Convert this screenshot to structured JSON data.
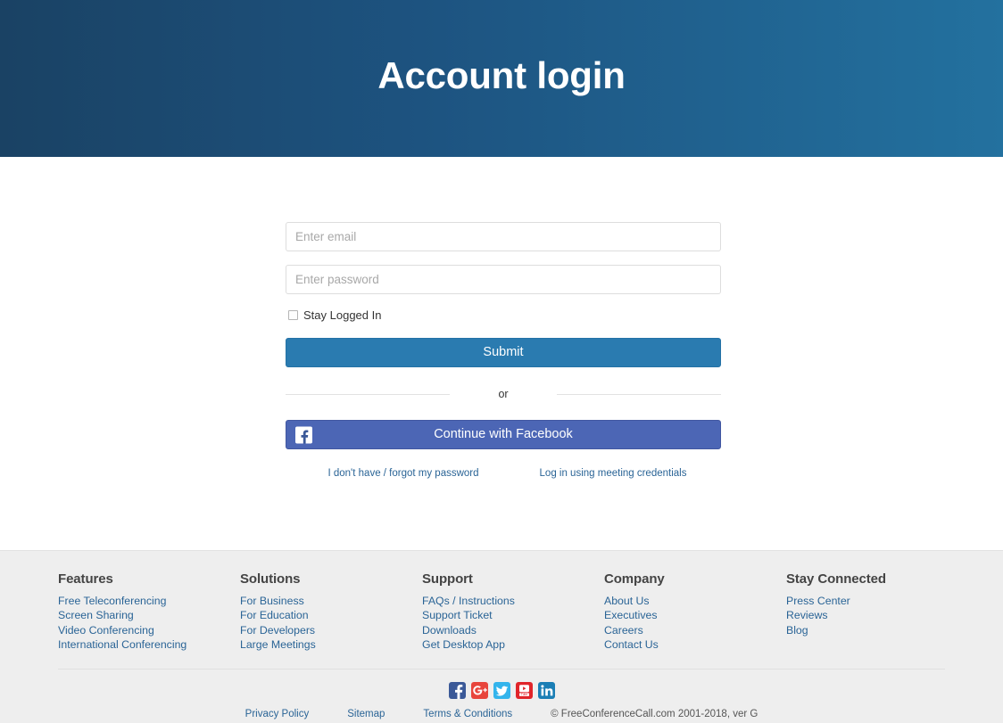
{
  "header": {
    "title": "Account login"
  },
  "form": {
    "email": {
      "value": "",
      "placeholder": "Enter email"
    },
    "password": {
      "value": "",
      "placeholder": "Enter password"
    },
    "stay_logged_in_label": "Stay Logged In",
    "submit_label": "Submit",
    "divider_text": "or",
    "facebook_label": "Continue with Facebook",
    "facebook_icon": "facebook-f-icon",
    "forgot_password_link": "I don't have / forgot my password",
    "meeting_credentials_link": "Log in using meeting credentials",
    "accent_color": "#2a7bb0",
    "facebook_color": "#4c66b5",
    "link_color": "#2a6496"
  },
  "footer": {
    "columns": [
      {
        "heading": "Features",
        "links": [
          "Free Teleconferencing",
          "Screen Sharing",
          "Video Conferencing",
          "International Conferencing"
        ]
      },
      {
        "heading": "Solutions",
        "links": [
          "For Business",
          "For Education",
          "For Developers",
          "Large Meetings"
        ]
      },
      {
        "heading": "Support",
        "links": [
          "FAQs / Instructions",
          "Support Ticket",
          "Downloads",
          "Get Desktop App"
        ]
      },
      {
        "heading": "Company",
        "links": [
          "About Us",
          "Executives",
          "Careers",
          "Contact Us"
        ]
      },
      {
        "heading": "Stay Connected",
        "links": [
          "Press Center",
          "Reviews",
          "Blog"
        ]
      }
    ],
    "social": [
      {
        "name": "facebook-icon",
        "color": "#3b5998"
      },
      {
        "name": "googleplus-icon",
        "color": "#e8453c"
      },
      {
        "name": "twitter-icon",
        "color": "#33b4ec"
      },
      {
        "name": "youtube-icon",
        "color": "#e0252a"
      },
      {
        "name": "linkedin-icon",
        "color": "#1a7eb5"
      }
    ],
    "bottom_links": [
      "Privacy Policy",
      "Sitemap",
      "Terms & Conditions"
    ],
    "copyright": "© FreeConferenceCall.com 2001-2018, ver G"
  }
}
